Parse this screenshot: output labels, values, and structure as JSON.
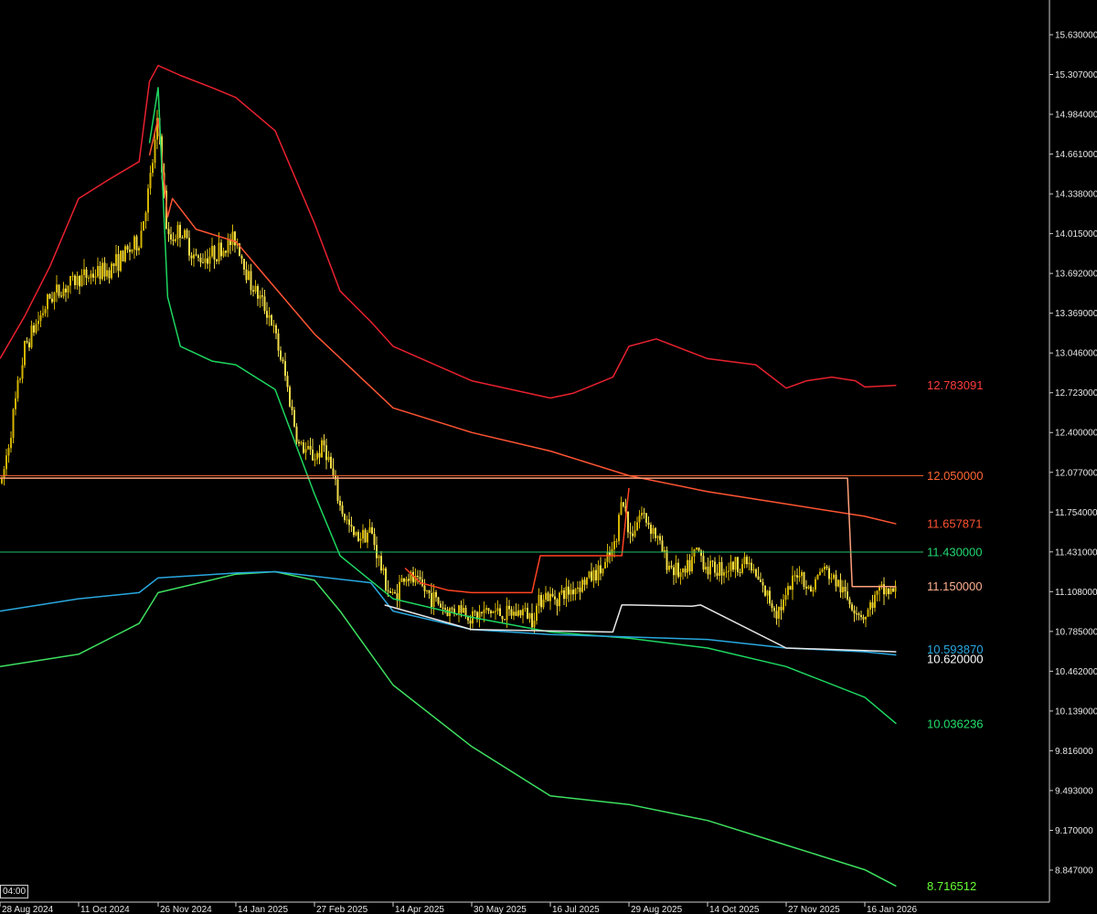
{
  "chart_data": {
    "type": "line",
    "title": "",
    "xlabel": "",
    "ylabel": "",
    "ylim": [
      8.65,
      15.75
    ],
    "x_ticks": [
      "28 Aug 2024",
      "11 Oct 2024",
      "26 Nov 2024",
      "14 Jan 2025",
      "27 Feb 2025",
      "14 Apr 2025",
      "30 May 2025",
      "16 Jul 2025",
      "29 Aug 2025",
      "14 Oct 2025",
      "27 Nov 2025",
      "16 Jan 2026"
    ],
    "y_ticks": [
      "15.630000",
      "15.307000",
      "14.984000",
      "14.661000",
      "14.338000",
      "14.015000",
      "13.692000",
      "13.369000",
      "13.046000",
      "12.723000",
      "12.400000",
      "12.077000",
      "11.754000",
      "11.431000",
      "11.108000",
      "10.785000",
      "10.462000",
      "10.139000",
      "9.816000",
      "9.493000",
      "9.170000",
      "8.847000"
    ],
    "crosshair_time_label": "04:00",
    "price_anchors": [
      [
        "28 Aug 2024",
        11.9
      ],
      [
        "11 Sep 2024",
        13.1
      ],
      [
        "25 Sep 2024",
        13.5
      ],
      [
        "11 Oct 2024",
        13.65
      ],
      [
        "28 Oct 2024",
        13.72
      ],
      [
        "15 Nov 2024",
        13.95
      ],
      [
        "21 Nov 2024",
        14.4
      ],
      [
        "26 Nov 2024",
        14.95
      ],
      [
        "02 Dec 2024",
        13.95
      ],
      [
        "10 Dec 2024",
        14.05
      ],
      [
        "20 Dec 2024",
        13.8
      ],
      [
        "30 Dec 2024",
        13.85
      ],
      [
        "07 Jan 2025",
        13.9
      ],
      [
        "14 Jan 2025",
        13.98
      ],
      [
        "22 Jan 2025",
        13.62
      ],
      [
        "02 Feb 2025",
        13.35
      ],
      [
        "10 Feb 2025",
        12.9
      ],
      [
        "18 Feb 2025",
        12.3
      ],
      [
        "27 Feb 2025",
        12.2
      ],
      [
        "05 Mar 2025",
        12.3
      ],
      [
        "14 Mar 2025",
        11.8
      ],
      [
        "22 Mar 2025",
        11.55
      ],
      [
        "01 Apr 2025",
        11.6
      ],
      [
        "09 Apr 2025",
        11.2
      ],
      [
        "14 Apr 2025",
        11.05
      ],
      [
        "21 Apr 2025",
        11.25
      ],
      [
        "30 Apr 2025",
        11.15
      ],
      [
        "08 May 2025",
        11.05
      ],
      [
        "16 May 2025",
        10.95
      ],
      [
        "24 May 2025",
        10.98
      ],
      [
        "30 May 2025",
        10.9
      ],
      [
        "10 Jun 2025",
        10.95
      ],
      [
        "20 Jun 2025",
        10.92
      ],
      [
        "30 Jun 2025",
        10.95
      ],
      [
        "05 Jul 2025",
        10.9
      ],
      [
        "12 Jul 2025",
        11.1
      ],
      [
        "16 Jul 2025",
        11.05
      ],
      [
        "25 Jul 2025",
        11.1
      ],
      [
        "05 Aug 2025",
        11.2
      ],
      [
        "15 Aug 2025",
        11.3
      ],
      [
        "22 Aug 2025",
        11.5
      ],
      [
        "25 Aug 2025",
        11.95
      ],
      [
        "29 Aug 2025",
        11.55
      ],
      [
        "05 Sep 2025",
        11.75
      ],
      [
        "12 Sep 2025",
        11.62
      ],
      [
        "20 Sep 2025",
        11.35
      ],
      [
        "30 Sep 2025",
        11.22
      ],
      [
        "08 Oct 2025",
        11.45
      ],
      [
        "14 Oct 2025",
        11.3
      ],
      [
        "24 Oct 2025",
        11.3
      ],
      [
        "05 Nov 2025",
        11.35
      ],
      [
        "15 Nov 2025",
        11.1
      ],
      [
        "22 Nov 2025",
        10.95
      ],
      [
        "27 Nov 2025",
        11.05
      ],
      [
        "05 Dec 2025",
        11.3
      ],
      [
        "12 Dec 2025",
        11.1
      ],
      [
        "20 Dec 2025",
        11.3
      ],
      [
        "28 Dec 2025",
        11.2
      ],
      [
        "05 Jan 2026",
        11.05
      ],
      [
        "12 Jan 2026",
        10.95
      ],
      [
        "16 Jan 2026",
        10.9
      ],
      [
        "22 Jan 2026",
        11.05
      ],
      [
        "28 Jan 2026",
        11.12
      ],
      [
        "05 Feb 2026",
        11.1
      ]
    ],
    "series": [
      {
        "role": "upper outer band",
        "color": "#e8212f",
        "values": [
          [
            "28 Aug 2024",
            13.0
          ],
          [
            "11 Sep 2024",
            13.35
          ],
          [
            "25 Sep 2024",
            13.75
          ],
          [
            "11 Oct 2024",
            14.3
          ],
          [
            "28 Oct 2024",
            14.45
          ],
          [
            "15 Nov 2024",
            14.6
          ],
          [
            "21 Nov 2024",
            15.25
          ],
          [
            "26 Nov 2024",
            15.38
          ],
          [
            "10 Dec 2024",
            15.3
          ],
          [
            "30 Dec 2024",
            15.2
          ],
          [
            "14 Jan 2025",
            15.12
          ],
          [
            "05 Feb 2025",
            14.85
          ],
          [
            "27 Feb 2025",
            14.1
          ],
          [
            "14 Mar 2025",
            13.55
          ],
          [
            "01 Apr 2025",
            13.3
          ],
          [
            "14 Apr 2025",
            13.1
          ],
          [
            "30 May 2025",
            12.82
          ],
          [
            "16 Jul 2025",
            12.68
          ],
          [
            "29 Jul 2025",
            12.72
          ],
          [
            "20 Aug 2025",
            12.85
          ],
          [
            "29 Aug 2025",
            13.1
          ],
          [
            "14 Sep 2025",
            13.16
          ],
          [
            "14 Oct 2025",
            13.0
          ],
          [
            "10 Nov 2025",
            12.95
          ],
          [
            "27 Nov 2025",
            12.76
          ],
          [
            "10 Dec 2025",
            12.82
          ],
          [
            "26 Dec 2025",
            12.85
          ],
          [
            "10 Jan 2026",
            12.82
          ],
          [
            "16 Jan 2026",
            12.77
          ],
          [
            "05 Feb 2026",
            12.783091
          ]
        ]
      },
      {
        "role": "upper middle band",
        "color": "#ff5533",
        "values": [
          [
            "21 Nov 2024",
            14.65
          ],
          [
            "26 Nov 2024",
            14.95
          ],
          [
            "02 Dec 2024",
            14.15
          ],
          [
            "05 Dec 2024",
            14.3
          ],
          [
            "20 Dec 2024",
            14.05
          ],
          [
            "14 Jan 2025",
            13.95
          ],
          [
            "27 Feb 2025",
            13.2
          ],
          [
            "14 Apr 2025",
            12.6
          ],
          [
            "30 May 2025",
            12.4
          ],
          [
            "16 Jul 2025",
            12.25
          ],
          [
            "29 Aug 2025",
            12.05
          ],
          [
            "14 Oct 2025",
            11.92
          ],
          [
            "27 Nov 2025",
            11.82
          ],
          [
            "16 Jan 2026",
            11.72
          ],
          [
            "05 Feb 2026",
            11.657871
          ]
        ]
      },
      {
        "role": "lower middle band",
        "color": "#1ed760",
        "values": [
          [
            "21 Nov 2024",
            14.75
          ],
          [
            "26 Nov 2024",
            15.2
          ],
          [
            "02 Dec 2024",
            13.5
          ],
          [
            "10 Dec 2024",
            13.1
          ],
          [
            "30 Dec 2024",
            12.98
          ],
          [
            "14 Jan 2025",
            12.95
          ],
          [
            "05 Feb 2025",
            12.75
          ],
          [
            "27 Feb 2025",
            11.9
          ],
          [
            "14 Mar 2025",
            11.4
          ],
          [
            "14 Apr 2025",
            11.05
          ],
          [
            "30 May 2025",
            10.9
          ],
          [
            "16 Jul 2025",
            10.78
          ],
          [
            "29 Aug 2025",
            10.73
          ],
          [
            "14 Oct 2025",
            10.65
          ],
          [
            "27 Nov 2025",
            10.5
          ],
          [
            "16 Jan 2026",
            10.25
          ],
          [
            "05 Feb 2026",
            10.036236
          ]
        ]
      },
      {
        "role": "lower outer band",
        "color": "#3ee060",
        "values": [
          [
            "28 Aug 2024",
            10.5
          ],
          [
            "11 Oct 2024",
            10.6
          ],
          [
            "15 Nov 2024",
            10.85
          ],
          [
            "26 Nov 2024",
            11.1
          ],
          [
            "14 Jan 2025",
            11.25
          ],
          [
            "05 Feb 2025",
            11.27
          ],
          [
            "27 Feb 2025",
            11.2
          ],
          [
            "14 Mar 2025",
            10.95
          ],
          [
            "14 Apr 2025",
            10.35
          ],
          [
            "30 May 2025",
            9.85
          ],
          [
            "16 Jul 2025",
            9.45
          ],
          [
            "29 Aug 2025",
            9.38
          ],
          [
            "14 Oct 2025",
            9.25
          ],
          [
            "27 Nov 2025",
            9.05
          ],
          [
            "16 Jan 2026",
            8.85
          ],
          [
            "05 Feb 2026",
            8.716512
          ]
        ]
      },
      {
        "role": "trailing level",
        "color": "#29a8e0",
        "values": [
          [
            "28 Aug 2024",
            10.95
          ],
          [
            "11 Oct 2024",
            11.05
          ],
          [
            "15 Nov 2024",
            11.1
          ],
          [
            "26 Nov 2024",
            11.22
          ],
          [
            "14 Jan 2025",
            11.26
          ],
          [
            "05 Feb 2025",
            11.27
          ],
          [
            "01 Apr 2025",
            11.18
          ],
          [
            "14 Apr 2025",
            10.95
          ],
          [
            "30 May 2025",
            10.8
          ],
          [
            "16 Jul 2025",
            10.76
          ],
          [
            "14 Oct 2025",
            10.72
          ],
          [
            "27 Nov 2025",
            10.65
          ],
          [
            "16 Jan 2026",
            10.62
          ],
          [
            "05 Feb 2026",
            10.59387
          ]
        ]
      },
      {
        "role": "stepped support",
        "color": "#e8e8e8",
        "values": [
          [
            "09 Apr 2025",
            11.0
          ],
          [
            "30 May 2025",
            10.8
          ],
          [
            "20 Aug 2025",
            10.78
          ],
          [
            "25 Aug 2025",
            11.0
          ],
          [
            "29 Aug 2025",
            11.0
          ],
          [
            "05 Oct 2025",
            10.99
          ],
          [
            "10 Oct 2025",
            11.0
          ],
          [
            "27 Nov 2025",
            10.65
          ],
          [
            "16 Jan 2026",
            10.63
          ],
          [
            "05 Feb 2026",
            10.62
          ]
        ]
      },
      {
        "role": "stepped resistance",
        "color": "#ff4422",
        "values": [
          [
            "21 Apr 2025",
            11.3
          ],
          [
            "30 Apr 2025",
            11.18
          ],
          [
            "16 May 2025",
            11.12
          ],
          [
            "30 May 2025",
            11.1
          ],
          [
            "05 Jul 2025",
            11.1
          ],
          [
            "10 Jul 2025",
            11.4
          ],
          [
            "25 Aug 2025",
            11.4
          ],
          [
            "29 Aug 2025",
            11.95
          ]
        ]
      },
      {
        "role": "salmon level",
        "color": "#ffa07a",
        "values": [
          [
            "28 Aug 2024",
            12.03
          ],
          [
            "05 Jan 2026",
            12.03
          ],
          [
            "08 Jan 2026",
            11.15
          ],
          [
            "05 Feb 2026",
            11.15
          ]
        ]
      }
    ],
    "horizontal_lines": [
      {
        "value": 12.05,
        "label": "12.050000",
        "color": "#ff6633"
      },
      {
        "value": 11.43,
        "label": "11.430000",
        "color": "#22c06b"
      }
    ],
    "right_labels": [
      {
        "value": 12.783091,
        "label": "12.783091",
        "color": "#ff3b3b"
      },
      {
        "value": 12.05,
        "label": "12.050000",
        "color": "#ff6633"
      },
      {
        "value": 11.657871,
        "label": "11.657871",
        "color": "#ff5533"
      },
      {
        "value": 11.43,
        "label": "11.430000",
        "color": "#22d870"
      },
      {
        "value": 11.15,
        "label": "11.150000",
        "color": "#ffb090"
      },
      {
        "value": 10.59387,
        "label": "10.593870",
        "color": "#29a8e0"
      },
      {
        "value": 10.62,
        "label": "10.620000",
        "color": "#ffffff"
      },
      {
        "value": 10.036236,
        "label": "10.036236",
        "color": "#22e06b"
      },
      {
        "value": 8.716512,
        "label": "8.716512",
        "color": "#66ff33"
      }
    ],
    "candle_colors": {
      "bull": "#d4b400",
      "bear": "#f2dc4a"
    }
  }
}
